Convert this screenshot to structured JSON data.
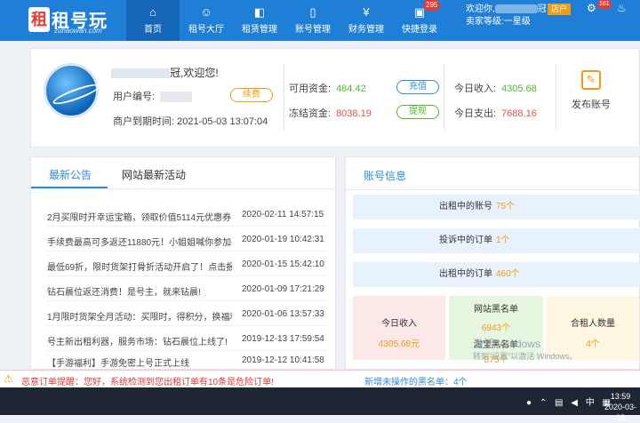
{
  "header": {
    "logo_mark": "租",
    "logo_text": "租号玩",
    "logo_sub": "zuhaowan.com",
    "nav": [
      {
        "label": "首页",
        "icon": "home-icon",
        "glyph": "⌂",
        "active": true
      },
      {
        "label": "租号大厅",
        "icon": "hall-icon",
        "glyph": "☺"
      },
      {
        "label": "租赁管理",
        "icon": "gamepad-icon",
        "glyph": "◧"
      },
      {
        "label": "账号管理",
        "icon": "phone-icon",
        "glyph": "▯"
      },
      {
        "label": "财务管理",
        "icon": "finance-icon",
        "glyph": "¥"
      },
      {
        "label": "快捷登录",
        "icon": "quick-login-icon",
        "glyph": "▣",
        "badge": "295"
      }
    ],
    "user_greeting": "欢迎你,",
    "user_suffix": "冠",
    "seller_level": "卖家等级:一星级",
    "vip_label": "店户",
    "notification_badge": "161"
  },
  "user_panel": {
    "welcome_suffix": "冠,欢迎您!",
    "user_id_label": "用户编号:",
    "renew_label": "续费",
    "expire_label": "商户到期时间:",
    "expire_value": "2021-05-03 13:07:04",
    "available_label": "可用资金:",
    "available_value": "484.42",
    "recharge_label": "充值",
    "frozen_label": "冻结资金:",
    "frozen_value": "8038.19",
    "withdraw_label": "提现",
    "today_income_label": "今日收入:",
    "today_income_value": "4305.68",
    "today_expense_label": "今日支出:",
    "today_expense_value": "7688.16",
    "publish_label": "发布账号"
  },
  "notice_panel": {
    "tab_active": "最新公告",
    "tab_other": "网站最新活动",
    "items": [
      {
        "title": "2月买限时开幸运宝箱，领取价值5114元优惠券!",
        "date": "2020-02-11 14:57:15"
      },
      {
        "title": "手续费最高可多返还11880元！小姐姐喊你参加手...",
        "date": "2020-01-19 10:42:31"
      },
      {
        "title": "最低69折，限时货架打骨折活动开启了！点击报名...",
        "date": "2020-01-15 15:42:10"
      },
      {
        "title": "钻石晨位返还消费！是号主，就来钻晨!",
        "date": "2020-01-09 17:21:29"
      },
      {
        "title": "1月限时货架全月活动：买限时，得积分，换福利!",
        "date": "2020-01-06 13:57:33"
      },
      {
        "title": "号主新出租利器，服务市场：钻石晨位上线了!",
        "date": "2019-12-13 17:59:54"
      },
      {
        "title": "【手游福利】手游免密上号正式上线",
        "date": "2019-12-12 10:41:58"
      }
    ]
  },
  "account_panel": {
    "title": "账号信息",
    "rows": [
      {
        "label": "出租中的账号",
        "value": "75个"
      },
      {
        "label": "投诉中的订单",
        "value": "1个"
      },
      {
        "label": "出租中的订单",
        "value": "460个"
      }
    ],
    "tiles": [
      {
        "label": "今日收入",
        "value": "4305.68元"
      },
      {
        "label": "网站黑名单",
        "value": "6943个",
        "label2": "淘宝黑名单",
        "value2": "875个"
      },
      {
        "label": "合租人数量",
        "value": "4个"
      }
    ],
    "watermark_line1": "激活 Windows",
    "watermark_line2": "转到\"设置\"以激活 Windows。"
  },
  "alert": {
    "text": "恶意订单提醒：您好，系统检测到您出租订单有10条是危险订单!",
    "blacklist_text": "新增未操作的黑名单：4个"
  },
  "taskbar": {
    "ime": "中",
    "time": "13:59",
    "date": "2020-03-28"
  },
  "colors": {
    "header_bg": "#1f7fd6",
    "accent_orange": "#f39c12",
    "green": "#52b830",
    "red": "#e2544f"
  }
}
